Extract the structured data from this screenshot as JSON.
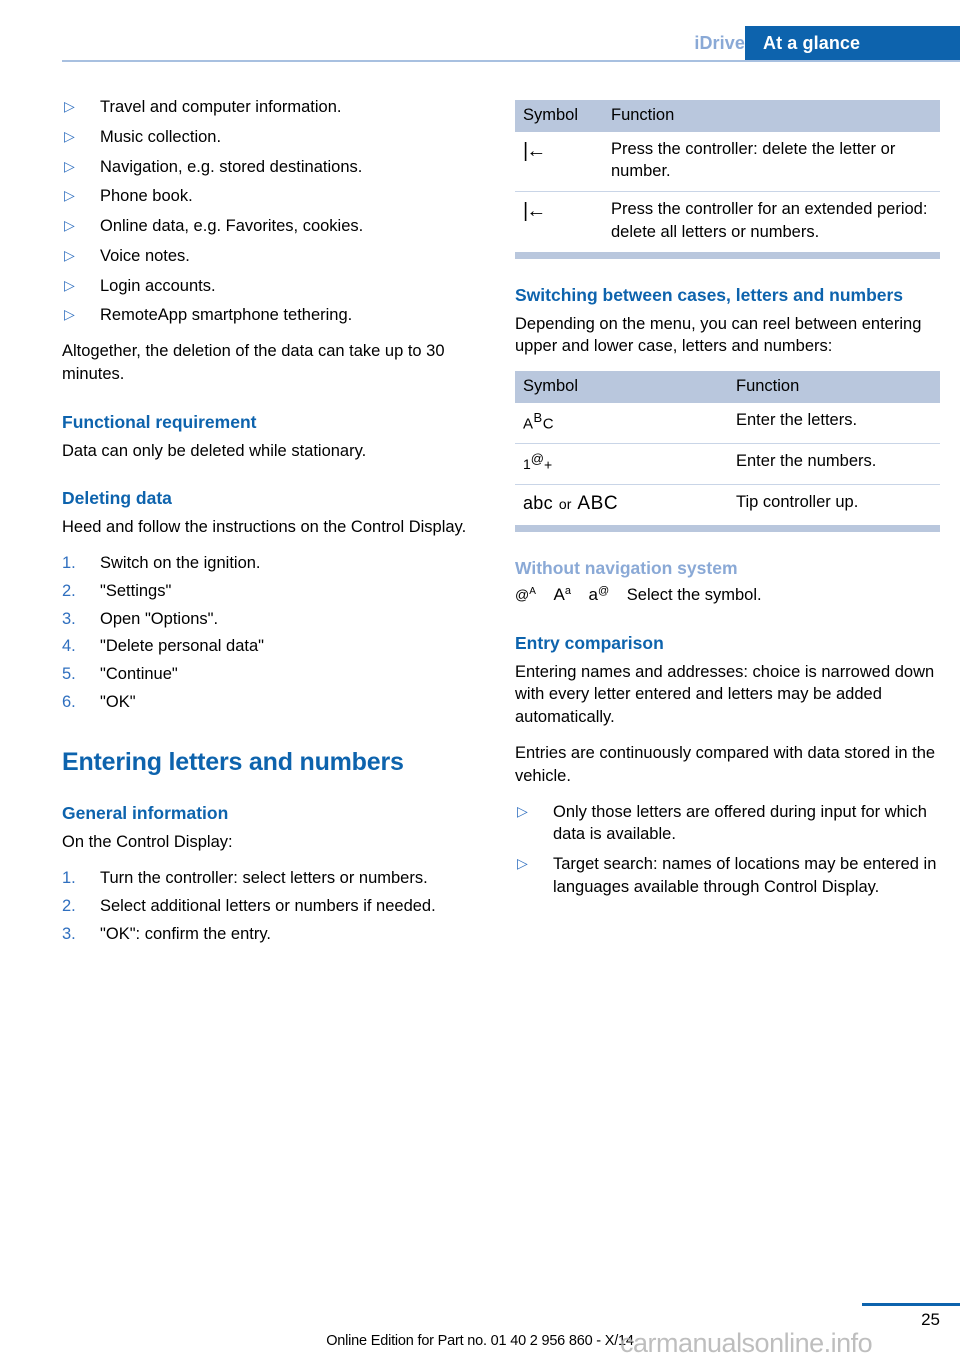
{
  "header": {
    "section": "iDrive",
    "chapter": "At a glance",
    "accent_color": "#0d63ad",
    "muted_color": "#8aa9d6"
  },
  "left_column": {
    "bullet_list_top": [
      "Travel and computer information.",
      "Music collection.",
      "Navigation, e.g. stored destinations.",
      "Phone book.",
      "Online data, e.g. Favorites, cookies.",
      "Voice notes.",
      "Login accounts.",
      "RemoteApp smartphone tethering."
    ],
    "paragraph_altogether": "Altogether, the deletion of the data can take up to 30 minutes.",
    "functional_requirement": {
      "heading": "Functional requirement",
      "body": "Data can only be deleted while stationary."
    },
    "deleting_data": {
      "heading": "Deleting data",
      "body": "Heed and follow the instructions on the Control Display.",
      "steps": [
        {
          "num": "1.",
          "text": "Switch on the ignition."
        },
        {
          "num": "2.",
          "text": "\"Settings\""
        },
        {
          "num": "3.",
          "text": "Open \"Options\"."
        },
        {
          "num": "4.",
          "text": "\"Delete personal data\""
        },
        {
          "num": "5.",
          "text": "\"Continue\""
        },
        {
          "num": "6.",
          "text": "\"OK\""
        }
      ]
    },
    "entering_letters": {
      "heading": "Entering letters and numbers",
      "general_information": {
        "heading": "General information",
        "body": "On the Control Display:",
        "steps": [
          {
            "num": "1.",
            "text": "Turn the controller: select letters or numbers."
          },
          {
            "num": "2.",
            "text": "Select additional letters or numbers if needed."
          },
          {
            "num": "3.",
            "text": "\"OK\": confirm the entry."
          }
        ]
      }
    }
  },
  "right_column": {
    "delete_table": {
      "columns": [
        "Symbol",
        "Function"
      ],
      "rows": [
        {
          "symbol": "|←",
          "symbol_name": "backspace-symbol",
          "function": "Press the controller: delete the letter or number."
        },
        {
          "symbol": "|←",
          "symbol_name": "backspace-symbol",
          "function": "Press the controller for an extended period: delete all letters or numbers."
        }
      ]
    },
    "switching_cases": {
      "heading": "Switching between cases, letters and numbers",
      "body": "Depending on the menu, you can reel between entering upper and lower case, letters and numbers:",
      "table": {
        "columns": [
          "Symbol",
          "Function"
        ],
        "rows": [
          {
            "symbol_parts": {
              "a": "A",
              "b": "B",
              "c": "C"
            },
            "symbol_name": "abc-mixed-symbol",
            "function": "Enter the letters."
          },
          {
            "symbol_parts": {
              "one": "1",
              "at": "@",
              "plus": "+"
            },
            "symbol_name": "number-symbol",
            "function": "Enter the numbers."
          },
          {
            "symbol_parts": {
              "lower": "abc",
              "conjunction": "or",
              "upper": "ABC"
            },
            "symbol_name": "case-toggle-symbol",
            "function": "Tip controller up."
          }
        ]
      }
    },
    "without_navigation": {
      "heading": "Without navigation system",
      "symbols": [
        {
          "base": "@",
          "sup": "A",
          "name": "at-upper-symbol"
        },
        {
          "base": "A",
          "sup": "a",
          "name": "upper-lower-symbol"
        },
        {
          "base": "a",
          "sup": "@",
          "name": "lower-at-symbol"
        }
      ],
      "text": "Select the symbol."
    },
    "entry_comparison": {
      "heading": "Entry comparison",
      "paragraph1": "Entering names and addresses: choice is narrowed down with every letter entered and letters may be added automatically.",
      "paragraph2": "Entries are continuously compared with data stored in the vehicle.",
      "bullets": [
        "Only those letters are offered during input for which data is available.",
        "Target search: names of locations may be entered in languages available through Control Display."
      ]
    }
  },
  "footer": {
    "page_number": "25",
    "edition_text": "Online Edition for Part no. 01 40 2 956 860 - X/14",
    "watermark": "carmanualsonline.info"
  }
}
